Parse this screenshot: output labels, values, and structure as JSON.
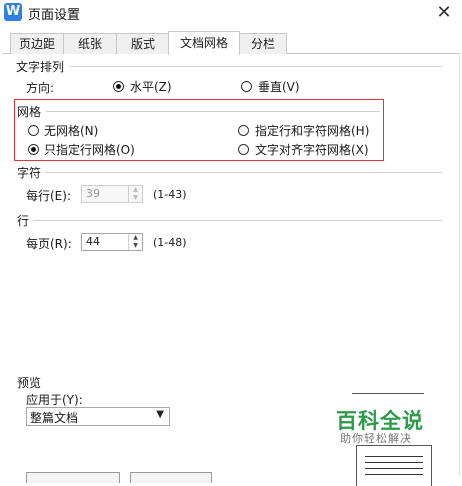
{
  "window": {
    "title": "页面设置",
    "close_glyph": "✕"
  },
  "tabs": [
    {
      "label": "页边距",
      "active": false
    },
    {
      "label": "纸张",
      "active": false
    },
    {
      "label": "版式",
      "active": false
    },
    {
      "label": "文档网格",
      "active": true
    },
    {
      "label": "分栏",
      "active": false
    }
  ],
  "text_direction": {
    "group_label": "文字排列",
    "field_label": "方向:",
    "options": [
      {
        "label": "水平(Z)",
        "checked": true
      },
      {
        "label": "垂直(V)",
        "checked": false
      }
    ]
  },
  "grid": {
    "group_label": "网格",
    "options": [
      {
        "label": "无网格(N)",
        "checked": false
      },
      {
        "label": "指定行和字符网格(H)",
        "checked": false
      },
      {
        "label": "只指定行网格(O)",
        "checked": true
      },
      {
        "label": "文字对齐字符网格(X)",
        "checked": false
      }
    ],
    "highlight_color": "#d9363e"
  },
  "chars": {
    "group_label": "字符",
    "field_label": "每行(E):",
    "value": "39",
    "range": "(1-43)",
    "disabled": true
  },
  "lines": {
    "group_label": "行",
    "field_label": "每页(R):",
    "value": "44",
    "range": "(1-48)"
  },
  "preview": {
    "group_label": "预览",
    "apply_label": "应用于(Y):",
    "apply_value": "整篇文档"
  },
  "watermark": {
    "title": "百科全说",
    "subtitle": "助你轻松解决",
    "color": "#2e9b4b"
  },
  "colors": {
    "accent": "#2f7fe4"
  }
}
